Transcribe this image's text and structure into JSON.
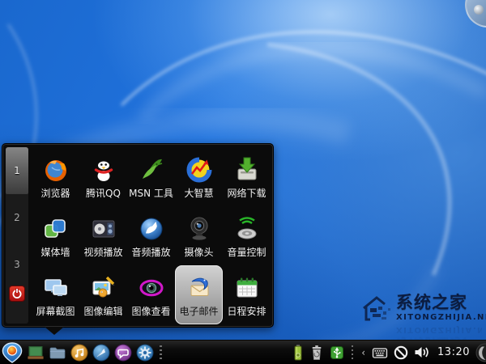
{
  "desktop": {
    "watermark": {
      "title": "系统之家",
      "subtitle": "XITONGZHIJIA.NET",
      "logo": "house-logo"
    },
    "corner_widget_icon": "logo-disc-icon"
  },
  "app_menu": {
    "pages": [
      {
        "label": "1",
        "selected": true
      },
      {
        "label": "2",
        "selected": false
      },
      {
        "label": "3",
        "selected": false
      }
    ],
    "power_button_icon": "power-icon",
    "selected_app": "电子邮件",
    "apps": [
      {
        "label": "浏览器",
        "icon": "firefox-browser-icon"
      },
      {
        "label": "腾讯QQ",
        "icon": "qq-penguin-icon"
      },
      {
        "label": "MSN 工具",
        "icon": "msn-bird-icon"
      },
      {
        "label": "大智慧",
        "icon": "stock-chart-icon"
      },
      {
        "label": "网络下载",
        "icon": "download-icon"
      },
      {
        "label": "媒体墙",
        "icon": "media-wall-icon"
      },
      {
        "label": "视频播放",
        "icon": "video-player-icon"
      },
      {
        "label": "音频播放",
        "icon": "audio-player-icon"
      },
      {
        "label": "摄像头",
        "icon": "webcam-icon"
      },
      {
        "label": "音量控制",
        "icon": "volume-control-icon"
      },
      {
        "label": "屏幕截图",
        "icon": "screenshot-icon"
      },
      {
        "label": "图像编辑",
        "icon": "image-editor-icon"
      },
      {
        "label": "图像查看",
        "icon": "image-viewer-icon"
      },
      {
        "label": "电子邮件",
        "icon": "thunderbird-mail-icon",
        "selected": true
      },
      {
        "label": "日程安排",
        "icon": "calendar-icon"
      }
    ]
  },
  "taskbar": {
    "launcher_icon": "launcher-pin-icon",
    "app_icons": [
      "desktop-board-icon",
      "file-manager-icon",
      "music-player-icon",
      "compass-browser-icon",
      "chat-bubble-icon",
      "settings-gear-icon"
    ],
    "tray_icons": [
      "battery-icon",
      "trash-icon",
      "usb-icon",
      "keyboard-icon",
      "disabled-input-icon",
      "speaker-icon"
    ],
    "collapse_glyph": "‹",
    "clock": "13:20",
    "corner_icon": "logo-disc-icon"
  },
  "colors": {
    "wallpaper_blue": "#1c6cd4",
    "menu_background": "#0b0b0b",
    "selection_gray": "#b9b9b9",
    "taskbar_black": "#0a0a0a",
    "power_red": "#c41414"
  }
}
